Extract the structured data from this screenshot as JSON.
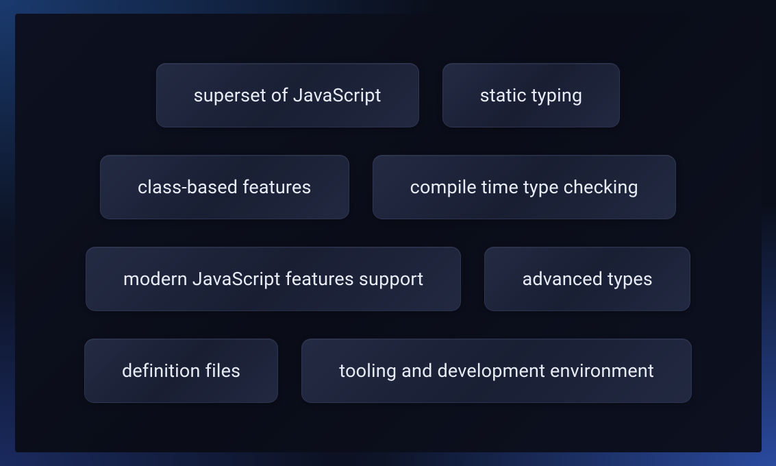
{
  "rows": [
    {
      "items": [
        "superset of JavaScript",
        "static typing"
      ]
    },
    {
      "items": [
        "class-based features",
        "compile time type checking"
      ]
    },
    {
      "items": [
        "modern JavaScript features support",
        "advanced types"
      ]
    },
    {
      "items": [
        "definition files",
        "tooling and development environment"
      ]
    }
  ]
}
